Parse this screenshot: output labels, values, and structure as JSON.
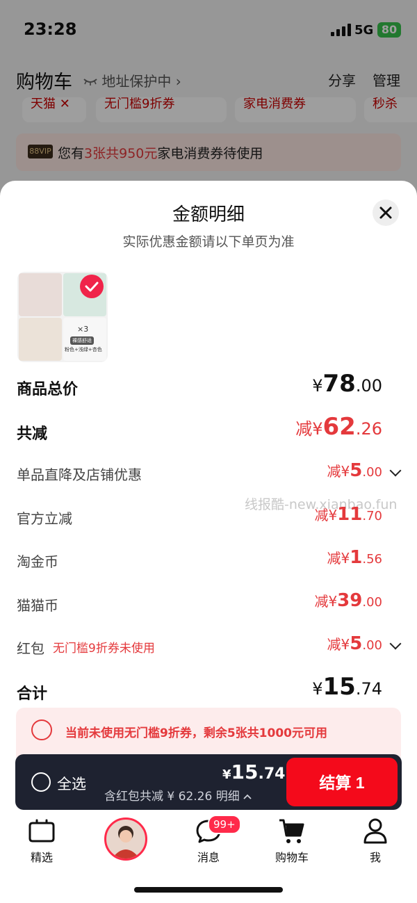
{
  "status_bar": {
    "time": "23:28",
    "network": "5G",
    "battery": "80"
  },
  "header": {
    "title": "购物车",
    "address_protect": "地址保护中",
    "share": "分享",
    "manage": "管理"
  },
  "filter_chips": [
    "天猫",
    "无门槛9折券",
    "家电消费券",
    "秒杀"
  ],
  "vip_banner": {
    "badge": "88VIP",
    "text_prefix": "您有",
    "highlight": "3张共950元",
    "text_suffix": "家电消费券待使用"
  },
  "sheet": {
    "title": "金额明细",
    "subtitle": "实际优惠金额请以下单页为准",
    "product_thumb": {
      "pack_label": "×3",
      "tag": "裸感舒适",
      "colors": "粉色+浅绿+杏色"
    },
    "rows": {
      "goods_total": {
        "label": "商品总价",
        "currency": "¥",
        "int": "78",
        "dec": ".00"
      },
      "total_reduce": {
        "label": "共减",
        "prefix": "减",
        "currency": "¥",
        "int": "62",
        "dec": ".26"
      },
      "item_shop": {
        "label": "单品直降及店铺优惠",
        "prefix": "减",
        "currency": "¥",
        "int": "5",
        "dec": ".00"
      },
      "official": {
        "label": "官方立减",
        "prefix": "减",
        "currency": "¥",
        "int": "11",
        "dec": ".70"
      },
      "taojinbi": {
        "label": "淘金币",
        "prefix": "减",
        "currency": "¥",
        "int": "1",
        "dec": ".56"
      },
      "maomaobi": {
        "label": "猫猫币",
        "prefix": "减",
        "currency": "¥",
        "int": "39",
        "dec": ".00"
      },
      "redpack": {
        "label": "红包",
        "note": "无门槛9折券未使用",
        "prefix": "减",
        "currency": "¥",
        "int": "5",
        "dec": ".00"
      },
      "sum": {
        "label": "合计",
        "currency": "¥",
        "int": "15",
        "dec": ".74"
      }
    },
    "watermark": "线报酷-new.xianbao.fun",
    "coupon_tip": "当前未使用无门槛9折券，剩余5张共1000元可用"
  },
  "checkout_bar": {
    "select_all": "全选",
    "currency": "¥",
    "total_int": "15",
    "total_dec": ".74",
    "discount_text": "含红包共减 ¥ 62.26 明细",
    "checkout_label": "结算 1"
  },
  "tab_bar": {
    "tabs": [
      {
        "label": "精选",
        "icon": "tv-icon"
      },
      {
        "label": "",
        "icon": "live-avatar"
      },
      {
        "label": "消息",
        "icon": "chat-bubble-icon",
        "badge": "99+"
      },
      {
        "label": "购物车",
        "icon": "cart-icon"
      },
      {
        "label": "我",
        "icon": "person-icon"
      }
    ]
  },
  "colors": {
    "accent": "#f40a1b",
    "discount": "#e4393c",
    "bar": "#1e2230"
  }
}
